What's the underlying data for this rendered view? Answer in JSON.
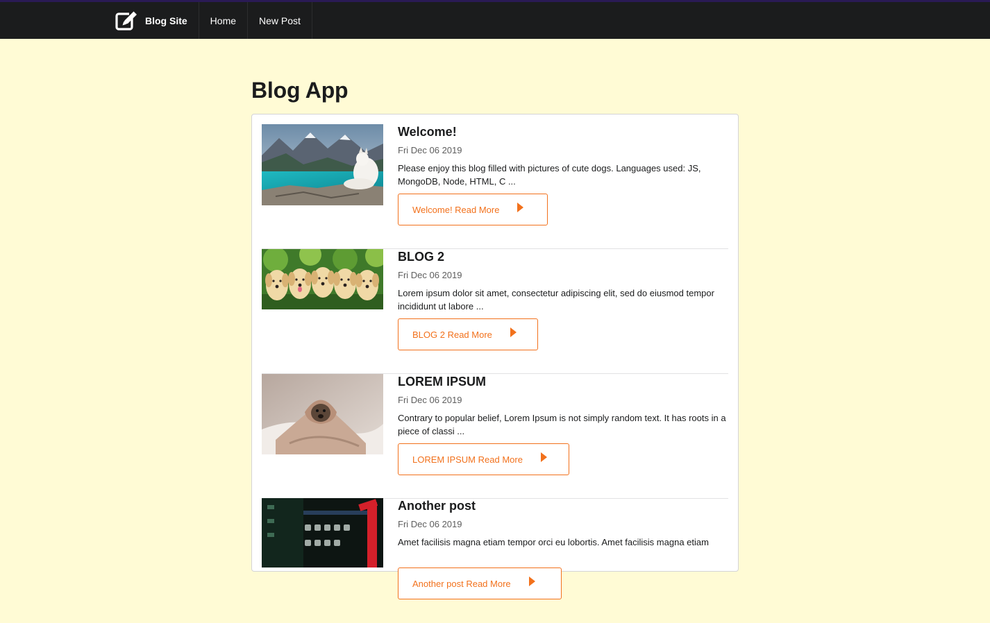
{
  "nav": {
    "brand_icon": "edit-icon",
    "brand": "Blog Site",
    "items": [
      {
        "label": "Home"
      },
      {
        "label": "New Post"
      }
    ]
  },
  "page": {
    "title": "Blog App"
  },
  "posts": [
    {
      "title": "Welcome!",
      "date": "Fri Dec 06 2019",
      "excerpt": "Please enjoy this blog filled with pictures of cute dogs. Languages used: JS, MongoDB, Node, HTML, C ...",
      "button": "Welcome! Read More",
      "image": "dog-lake-mountains-image"
    },
    {
      "title": "BLOG 2",
      "date": "Fri Dec 06 2019",
      "excerpt": "Lorem ipsum dolor sit amet, consectetur adipiscing elit, sed do eiusmod tempor incididunt ut labore ...",
      "button": "BLOG 2 Read More",
      "image": "puppies-grass-image"
    },
    {
      "title": "LOREM IPSUM",
      "date": "Fri Dec 06 2019",
      "excerpt": "Contrary to popular belief, Lorem Ipsum is not simply random text. It has roots in a piece of classi ...",
      "button": "LOREM IPSUM Read More",
      "image": "pug-blanket-image"
    },
    {
      "title": "Another post",
      "date": "Fri Dec 06 2019",
      "excerpt": "Amet facilisis magna etiam tempor orci eu lobortis. Amet facilisis magna etiam",
      "button": "Another post Read More",
      "image": "blurry-lights-image"
    }
  ],
  "colors": {
    "navbar": "#1b1c1d",
    "page_background": "#fffbd5",
    "accent": "#f2711c"
  }
}
